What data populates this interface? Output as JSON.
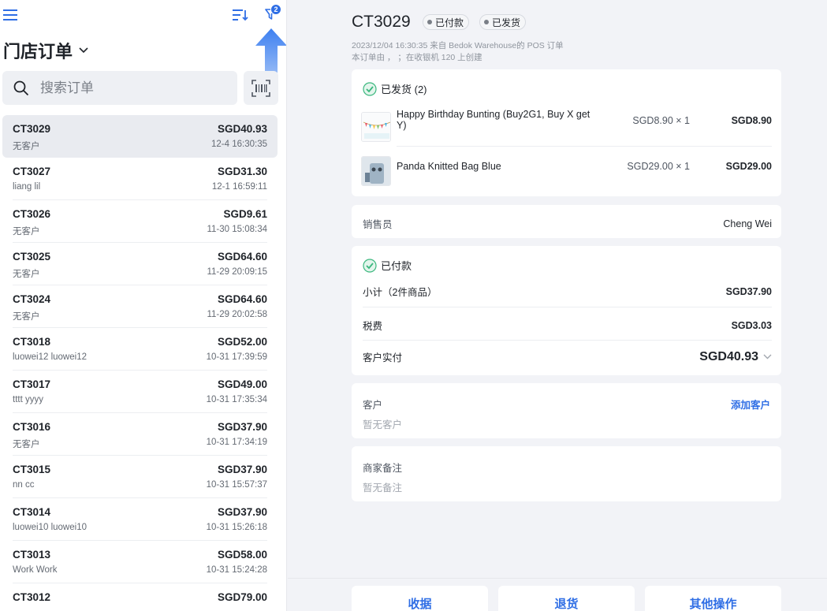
{
  "colors": {
    "accent": "#2f6ee5",
    "success": "#3bb77e",
    "background": "#f2f3f7"
  },
  "sidebar": {
    "title": "门店订单",
    "filter_badge": "2",
    "search": {
      "placeholder": "搜索订单",
      "value": ""
    },
    "orders": [
      {
        "id": "CT3029",
        "amount": "SGD40.93",
        "customer": "无客户",
        "time": "12-4 16:30:35",
        "selected": true
      },
      {
        "id": "CT3027",
        "amount": "SGD31.30",
        "customer": "liang lil",
        "time": "12-1 16:59:11"
      },
      {
        "id": "CT3026",
        "amount": "SGD9.61",
        "customer": "无客户",
        "time": "11-30 15:08:34"
      },
      {
        "id": "CT3025",
        "amount": "SGD64.60",
        "customer": "无客户",
        "time": "11-29 20:09:15"
      },
      {
        "id": "CT3024",
        "amount": "SGD64.60",
        "customer": "无客户",
        "time": "11-29 20:02:58"
      },
      {
        "id": "CT3018",
        "amount": "SGD52.00",
        "customer": "luowei12 luowei12",
        "time": "10-31 17:39:59"
      },
      {
        "id": "CT3017",
        "amount": "SGD49.00",
        "customer": "tttt yyyy",
        "time": "10-31 17:35:34"
      },
      {
        "id": "CT3016",
        "amount": "SGD37.90",
        "customer": "无客户",
        "time": "10-31 17:34:19"
      },
      {
        "id": "CT3015",
        "amount": "SGD37.90",
        "customer": "nn cc",
        "time": "10-31 15:57:37"
      },
      {
        "id": "CT3014",
        "amount": "SGD37.90",
        "customer": "luowei10 luowei10",
        "time": "10-31 15:26:18"
      },
      {
        "id": "CT3013",
        "amount": "SGD58.00",
        "customer": "Work Work",
        "time": "10-31 15:24:28"
      },
      {
        "id": "CT3012",
        "amount": "SGD79.00",
        "customer": "",
        "time": ""
      }
    ]
  },
  "order": {
    "id": "CT3029",
    "tags": {
      "paid": "已付款",
      "shipped": "已发货"
    },
    "meta_line1": "2023/12/04 16:30:35 来自 Bedok Warehouse的 POS 订单",
    "meta_line2": "本订单由 ， ；在收银机 120 上创建",
    "shipped_section": {
      "title": "已发货 (2)",
      "items": [
        {
          "name": "Happy Birthday Bunting (Buy2G1, Buy X get Y)",
          "unit_qty": "SGD8.90 × 1",
          "total": "SGD8.90"
        },
        {
          "name": "Panda Knitted Bag Blue",
          "unit_qty": "SGD29.00 × 1",
          "total": "SGD29.00"
        }
      ]
    },
    "salesperson": {
      "label": "销售员",
      "value": "Cheng Wei"
    },
    "payment": {
      "title": "已付款",
      "subtotal_label": "小计（2件商品）",
      "subtotal": "SGD37.90",
      "tax_label": "税费",
      "tax": "SGD3.03",
      "paid_label": "客户实付",
      "paid": "SGD40.93"
    },
    "customer": {
      "label": "客户",
      "empty": "暂无客户",
      "add_label": "添加客户"
    },
    "note": {
      "label": "商家备注",
      "empty": "暂无备注"
    }
  },
  "actions": {
    "receipt": "收据",
    "return": "退货",
    "more": "其他操作"
  }
}
